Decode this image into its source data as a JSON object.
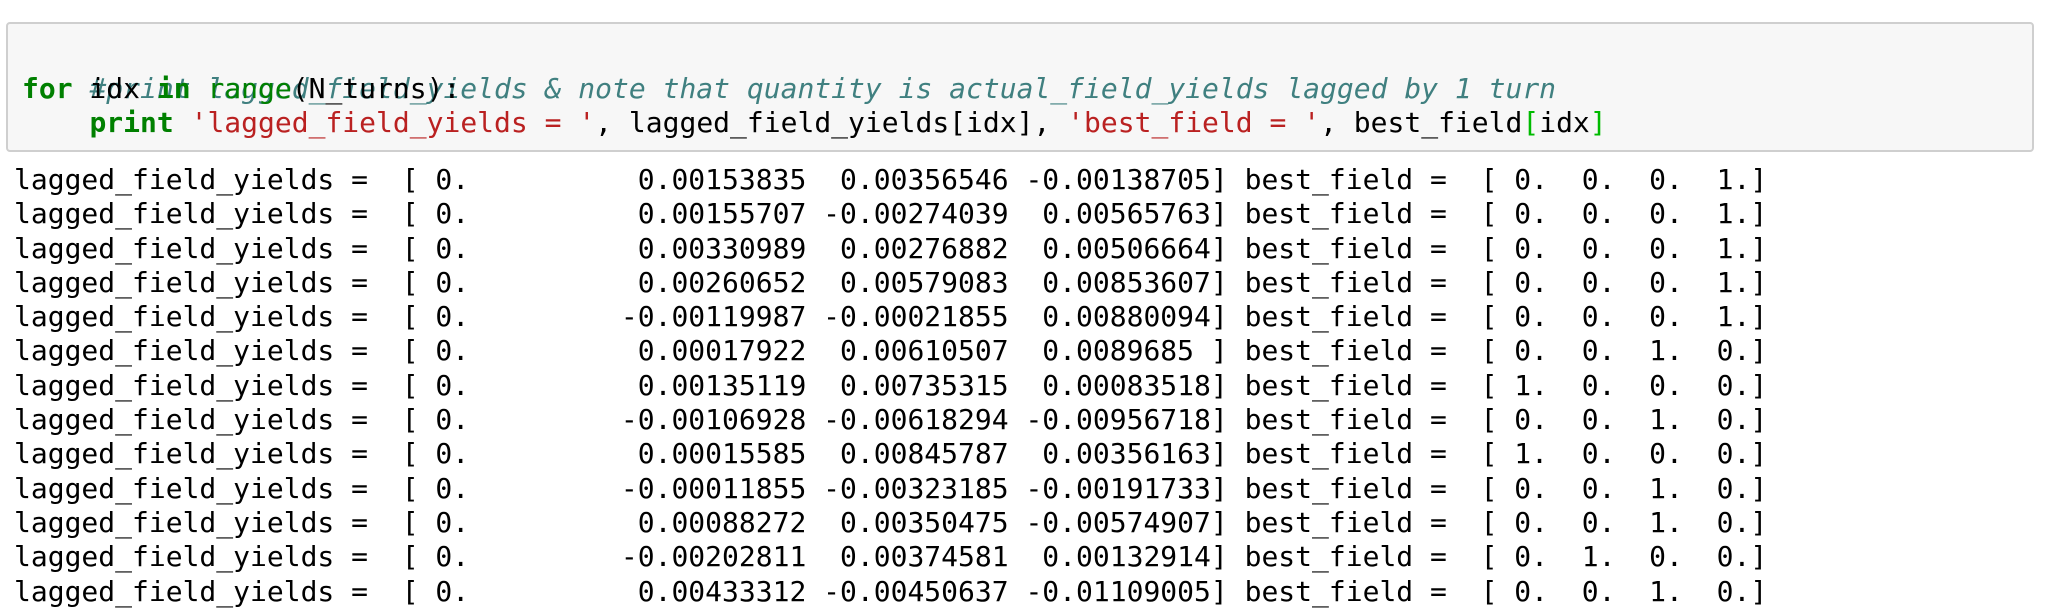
{
  "input_cell": {
    "comment": "#print lagged_field_yields & note that quantity is actual_field_yields lagged by 1 turn",
    "line2": {
      "kw_for": "for",
      "var": " idx ",
      "kw_in": "in",
      "space": " ",
      "builtin_range": "range",
      "rest": "(N_turns):"
    },
    "line3": {
      "indent": "    ",
      "kw_print": "print",
      "space": " ",
      "str1": "'lagged_field_yields = '",
      "mid": ", lagged_field_yields[idx], ",
      "str2": "'best_field = '",
      "tail": ", best_field",
      "br_open": "[",
      "idx": "idx",
      "br_close": "]"
    }
  },
  "output": {
    "lines": [
      "lagged_field_yields =  [ 0.          0.00153835  0.00356546 -0.00138705] best_field =  [ 0.  0.  0.  1.]",
      "lagged_field_yields =  [ 0.          0.00155707 -0.00274039  0.00565763] best_field =  [ 0.  0.  0.  1.]",
      "lagged_field_yields =  [ 0.          0.00330989  0.00276882  0.00506664] best_field =  [ 0.  0.  0.  1.]",
      "lagged_field_yields =  [ 0.          0.00260652  0.00579083  0.00853607] best_field =  [ 0.  0.  0.  1.]",
      "lagged_field_yields =  [ 0.         -0.00119987 -0.00021855  0.00880094] best_field =  [ 0.  0.  0.  1.]",
      "lagged_field_yields =  [ 0.          0.00017922  0.00610507  0.0089685 ] best_field =  [ 0.  0.  1.  0.]",
      "lagged_field_yields =  [ 0.          0.00135119  0.00735315  0.00083518] best_field =  [ 1.  0.  0.  0.]",
      "lagged_field_yields =  [ 0.         -0.00106928 -0.00618294 -0.00956718] best_field =  [ 0.  0.  1.  0.]",
      "lagged_field_yields =  [ 0.          0.00015585  0.00845787  0.00356163] best_field =  [ 1.  0.  0.  0.]",
      "lagged_field_yields =  [ 0.         -0.00011855 -0.00323185 -0.00191733] best_field =  [ 0.  0.  1.  0.]",
      "lagged_field_yields =  [ 0.          0.00088272  0.00350475 -0.00574907] best_field =  [ 0.  0.  1.  0.]",
      "lagged_field_yields =  [ 0.         -0.00202811  0.00374581  0.00132914] best_field =  [ 0.  1.  0.  0.]",
      "lagged_field_yields =  [ 0.          0.00433312 -0.00450637 -0.01109005] best_field =  [ 0.  0.  1.  0.]"
    ]
  },
  "colors": {
    "comment": "#408080",
    "keyword": "#008000",
    "string": "#ba2121",
    "matching_bracket": "#00bb00",
    "cell_background": "#f7f7f7",
    "cell_border": "#cfcfcf"
  }
}
